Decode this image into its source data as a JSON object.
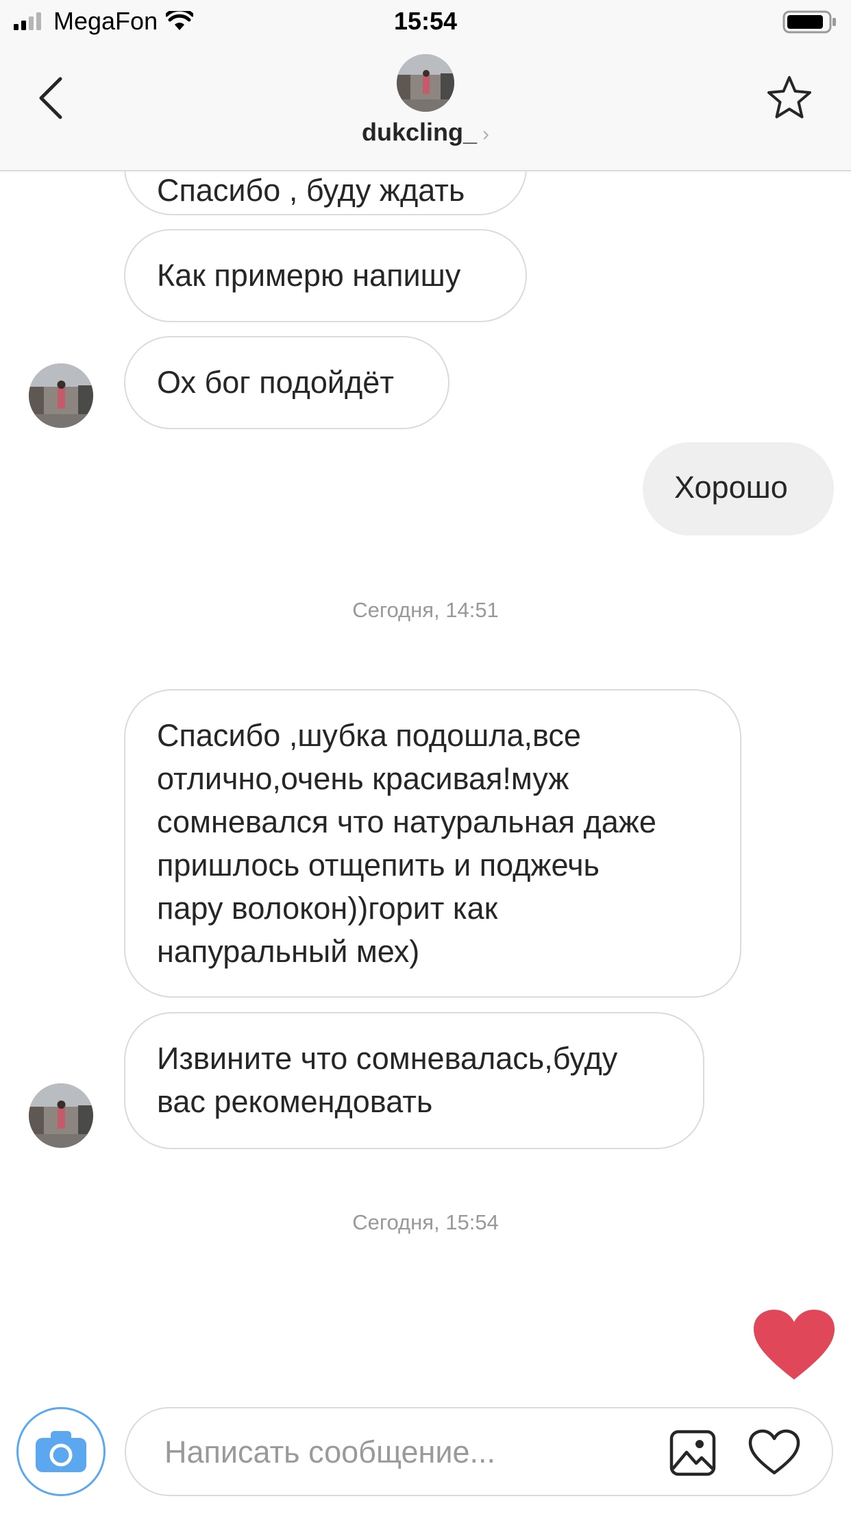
{
  "status_bar": {
    "carrier": "MegaFon",
    "time": "15:54"
  },
  "header": {
    "username": "dukcling_"
  },
  "messages": [
    {
      "text": "Спасибо , буду ждать",
      "direction": "incoming"
    },
    {
      "text": "Как примерю напишу",
      "direction": "incoming"
    },
    {
      "text": "Ох бог подойдёт",
      "direction": "incoming"
    },
    {
      "text": "Хорошо",
      "direction": "outgoing"
    },
    {
      "text": "Спасибо ,шубка подошла,все\nотлично,очень красивая!муж\nсомневался что натуральная даже\nпришлось отщепить и поджечь\nпару волокон))горит как\nнапуральный мех)",
      "direction": "incoming"
    },
    {
      "text": "Извините что сомневалась,буду\nвас рекомендовать",
      "direction": "incoming"
    }
  ],
  "timestamps": [
    "Сегодня, 14:51",
    "Сегодня, 15:54"
  ],
  "composer": {
    "placeholder": "Написать сообщение..."
  },
  "colors": {
    "like_heart": "#e0485a",
    "camera_accent": "#5ba8f0",
    "bubble_border": "#dbdbdb",
    "outgoing_bubble": "#efefef"
  },
  "icons": [
    "back-arrow-icon",
    "star-icon",
    "camera-icon",
    "gallery-icon",
    "heart-outline-icon",
    "heart-filled-icon",
    "wifi-icon",
    "battery-icon",
    "signal-icon",
    "chevron-right-icon"
  ]
}
